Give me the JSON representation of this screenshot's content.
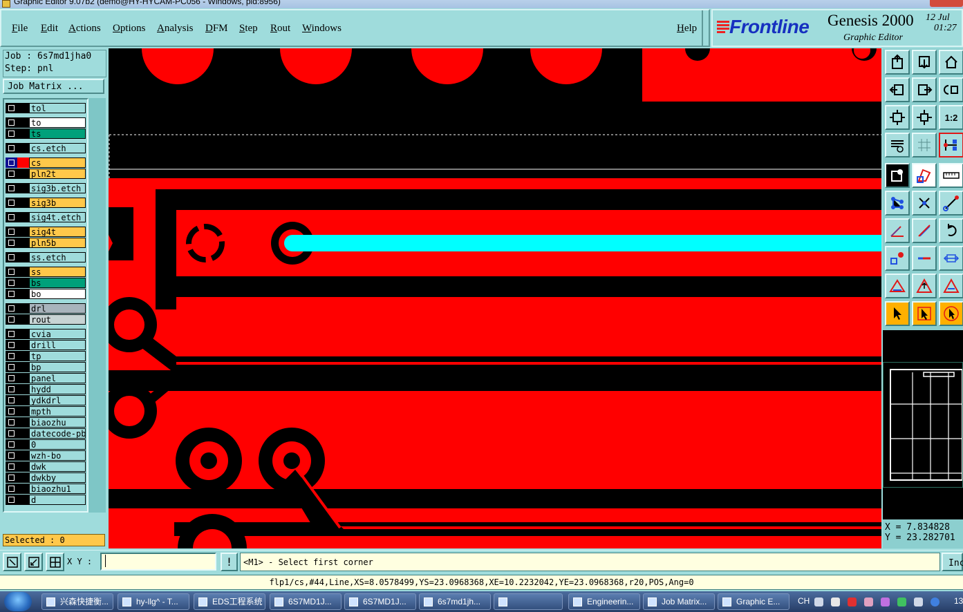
{
  "window": {
    "title": "Graphic Editor 9.07b2 (demo@HY-HYCAM-PC056 - Windows, pid:8956)"
  },
  "menu": {
    "file": "File",
    "edit": "Edit",
    "actions": "Actions",
    "options": "Options",
    "analysis": "Analysis",
    "dfm": "DFM",
    "step": "Step",
    "rout": "Rout",
    "windows": "Windows",
    "help": "Help"
  },
  "logo": {
    "brand": "Frontline",
    "product": "Genesis 2000",
    "subtitle": "Graphic Editor",
    "date": "12 Jul",
    "time": "01:27"
  },
  "job": {
    "job_line": "Job : 6s7md1jha0",
    "step_line": "Step: pnl",
    "matrix_button": "Job Matrix ..."
  },
  "colors": {
    "red": "#ff0000",
    "cyan": "#00ffff",
    "yellow": "#ffc84a",
    "green": "#00a07a",
    "white": "#ffffff",
    "cyanlayer": "#9fdcdc",
    "gray": "#b4b4b4",
    "drl": "#a8b4bc"
  },
  "layers": [
    {
      "name": "tol",
      "fill": "#9fdcdc",
      "swatch": "#000000",
      "selected": false
    },
    {
      "name": "to",
      "fill": "#ffffff",
      "swatch": "#000000",
      "selected": false
    },
    {
      "name": "ts",
      "fill": "#00a07a",
      "swatch": "#000000",
      "selected": false
    },
    {
      "name": "cs.etch",
      "fill": "#9fdcdc",
      "swatch": "#000000",
      "selected": false
    },
    {
      "name": "cs",
      "fill": "#ffc84a",
      "swatch": "#ff0000",
      "selected": true
    },
    {
      "name": "pln2t",
      "fill": "#ffc84a",
      "swatch": "#000000",
      "selected": false
    },
    {
      "name": "sig3b.etch",
      "fill": "#9fdcdc",
      "swatch": "#000000",
      "selected": false
    },
    {
      "name": "sig3b",
      "fill": "#ffc84a",
      "swatch": "#000000",
      "selected": false
    },
    {
      "name": "sig4t.etch",
      "fill": "#9fdcdc",
      "swatch": "#000000",
      "selected": false
    },
    {
      "name": "sig4t",
      "fill": "#ffc84a",
      "swatch": "#000000",
      "selected": false
    },
    {
      "name": "pln5b",
      "fill": "#ffc84a",
      "swatch": "#000000",
      "selected": false
    },
    {
      "name": "ss.etch",
      "fill": "#9fdcdc",
      "swatch": "#000000",
      "selected": false
    },
    {
      "name": "ss",
      "fill": "#ffc84a",
      "swatch": "#000000",
      "selected": false
    },
    {
      "name": "bs",
      "fill": "#00a07a",
      "swatch": "#000000",
      "selected": false
    },
    {
      "name": "bo",
      "fill": "#ffffff",
      "swatch": "#000000",
      "selected": false
    },
    {
      "name": "drl",
      "fill": "#a8b4bc",
      "swatch": "#000000",
      "selected": false
    },
    {
      "name": "rout",
      "fill": "#c8d4d4",
      "swatch": "#000000",
      "selected": false
    },
    {
      "name": "cvia",
      "fill": "#9fdcdc",
      "swatch": "#000000",
      "selected": false
    },
    {
      "name": "drill",
      "fill": "#9fdcdc",
      "swatch": "#000000",
      "selected": false
    },
    {
      "name": "tp",
      "fill": "#9fdcdc",
      "swatch": "#000000",
      "selected": false
    },
    {
      "name": "bp",
      "fill": "#9fdcdc",
      "swatch": "#000000",
      "selected": false
    },
    {
      "name": "panel",
      "fill": "#9fdcdc",
      "swatch": "#000000",
      "selected": false
    },
    {
      "name": "hydd",
      "fill": "#9fdcdc",
      "swatch": "#000000",
      "selected": false
    },
    {
      "name": "ydkdrl",
      "fill": "#9fdcdc",
      "swatch": "#000000",
      "selected": false
    },
    {
      "name": "mpth",
      "fill": "#9fdcdc",
      "swatch": "#000000",
      "selected": false
    },
    {
      "name": "biaozhu",
      "fill": "#9fdcdc",
      "swatch": "#000000",
      "selected": false
    },
    {
      "name": "datecode-pbo",
      "fill": "#9fdcdc",
      "swatch": "#000000",
      "selected": false
    },
    {
      "name": "0",
      "fill": "#9fdcdc",
      "swatch": "#000000",
      "selected": false
    },
    {
      "name": "wzh-bo",
      "fill": "#9fdcdc",
      "swatch": "#000000",
      "selected": false
    },
    {
      "name": "dwk",
      "fill": "#9fdcdc",
      "swatch": "#000000",
      "selected": false
    },
    {
      "name": "dwkby",
      "fill": "#9fdcdc",
      "swatch": "#000000",
      "selected": false
    },
    {
      "name": "biaozhu1",
      "fill": "#9fdcdc",
      "swatch": "#000000",
      "selected": false
    },
    {
      "name": "d",
      "fill": "#9fdcdc",
      "swatch": "#000000",
      "selected": false
    }
  ],
  "selection": {
    "text": "Selected : 0"
  },
  "coords": {
    "x": "X = 7.834828",
    "y": "Y = 23.282701"
  },
  "toolbox": {
    "ratio_label": "1:2"
  },
  "command": {
    "xy_label": "X Y :",
    "xy_value": "",
    "bang": "!",
    "prompt": "<M1> - Select first corner",
    "inc_label": "Inc"
  },
  "info": {
    "line": "flp1/cs,#44,Line,XS=8.0578499,YS=23.0968368,XE=10.2232042,YE=23.0968368,r20,POS,Ang=0"
  },
  "taskbar": {
    "items": [
      "兴森快捷衡...",
      "hy-llg^ - T...",
      "EDS工程系统",
      "6S7MD1J...",
      "6S7MD1J...",
      "6s7md1jh...",
      "",
      "Engineerin...",
      "Job Matrix...",
      "Graphic E..."
    ],
    "lang": "CH",
    "clock": "13"
  }
}
